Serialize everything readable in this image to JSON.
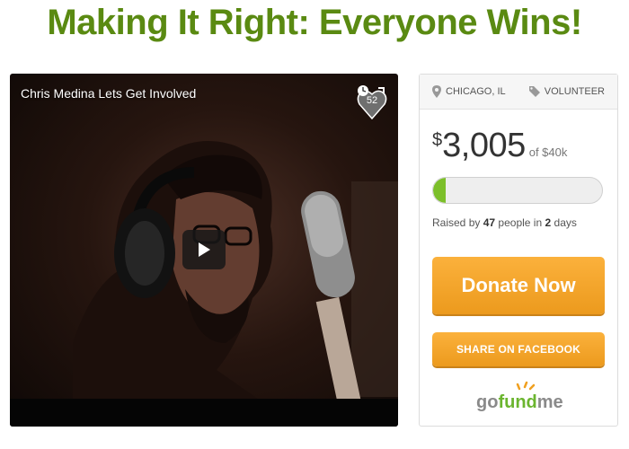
{
  "page": {
    "title": "Making It Right: Everyone Wins!"
  },
  "colors": {
    "title_green": "#5a8a12",
    "progress_green": "#7cbf2a",
    "button_orange": "#f5a524",
    "logo_green": "#6bb52f",
    "logo_gray": "#8a8a8a"
  },
  "video": {
    "title": "Chris Medina Lets Get Involved",
    "badge_count": "52",
    "play_icon": "play-icon",
    "badge_icon": "heart-clock-icon"
  },
  "campaign": {
    "location": "CHICAGO, IL",
    "category": "VOLUNTEER",
    "location_icon": "map-pin-icon",
    "category_icon": "tag-icon",
    "currency_symbol": "$",
    "raised": "3,005",
    "goal": "of $40k",
    "progress": 0.075,
    "raised_by_prefix": "Raised by",
    "people_count": "47",
    "people_suffix": "people in",
    "days_count": "2",
    "days_suffix": "days"
  },
  "actions": {
    "donate_label": "Donate Now",
    "share_label": "SHARE ON FACEBOOK"
  },
  "brand": {
    "logo_left": "go",
    "logo_middle": "fund",
    "logo_right": "me"
  }
}
